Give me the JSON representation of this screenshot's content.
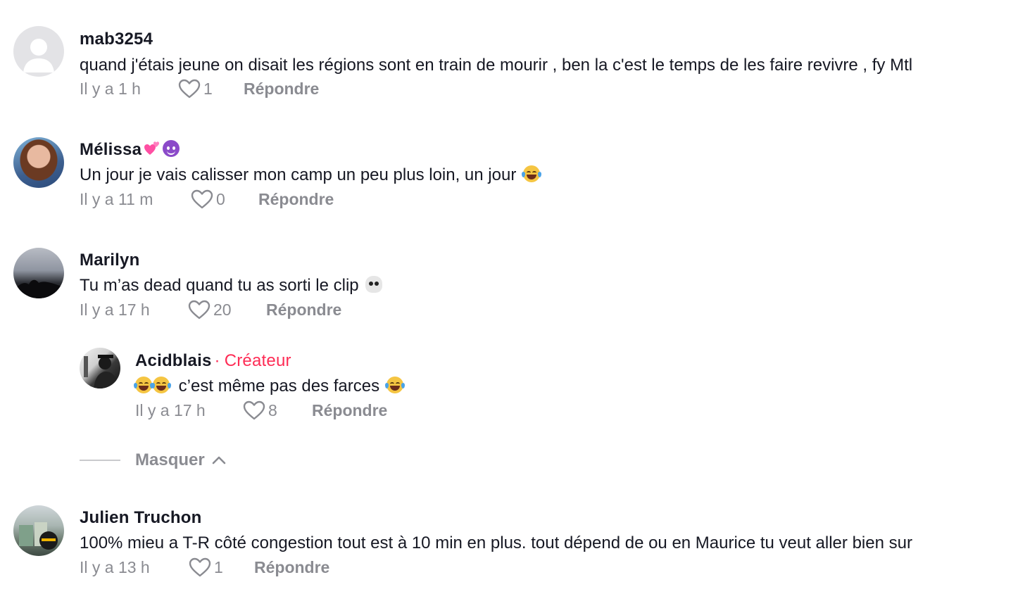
{
  "comments": [
    {
      "username": "mab3254",
      "text": "quand j'étais jeune on disait les régions sont en train de mourir , ben la c'est le temps de les faire revivre , fy Mtl",
      "time": "Il y a 1 h",
      "likes": "1",
      "reply_label": "Répondre"
    },
    {
      "username": "Mélissa",
      "text": "Un jour je vais calisser mon camp un peu plus loin, un jour",
      "time": "Il y a 11 m",
      "likes": "0",
      "reply_label": "Répondre"
    },
    {
      "username": "Marilyn",
      "text": "Tu m’as dead quand tu as sorti le clip",
      "time": "Il y a 17 h",
      "likes": "20",
      "reply_label": "Répondre",
      "replies": [
        {
          "username": "Acidblais",
          "creator_separator": "·",
          "creator_label": "Créateur",
          "text": "c’est même pas des farces",
          "time": "Il y a 17 h",
          "likes": "8",
          "reply_label": "Répondre"
        }
      ],
      "hide_label": "Masquer"
    },
    {
      "username": "Julien Truchon",
      "text": "100% mieu a T-R côté congestion tout est à 10 min en plus. tout dépend de ou en Maurice tu veut aller bien sur",
      "time": "Il y a 13 h",
      "likes": "1",
      "reply_label": "Répondre"
    }
  ],
  "colors": {
    "text": "#161823",
    "meta": "#8a8b91",
    "creator": "#fe2c55",
    "divider": "#c9cacd"
  },
  "icons": [
    "heart-outline-icon",
    "chevron-up-icon",
    "face-with-tears-of-joy-emoji",
    "skull-emoji",
    "two-hearts-emoji",
    "smiling-devil-emoji"
  ]
}
